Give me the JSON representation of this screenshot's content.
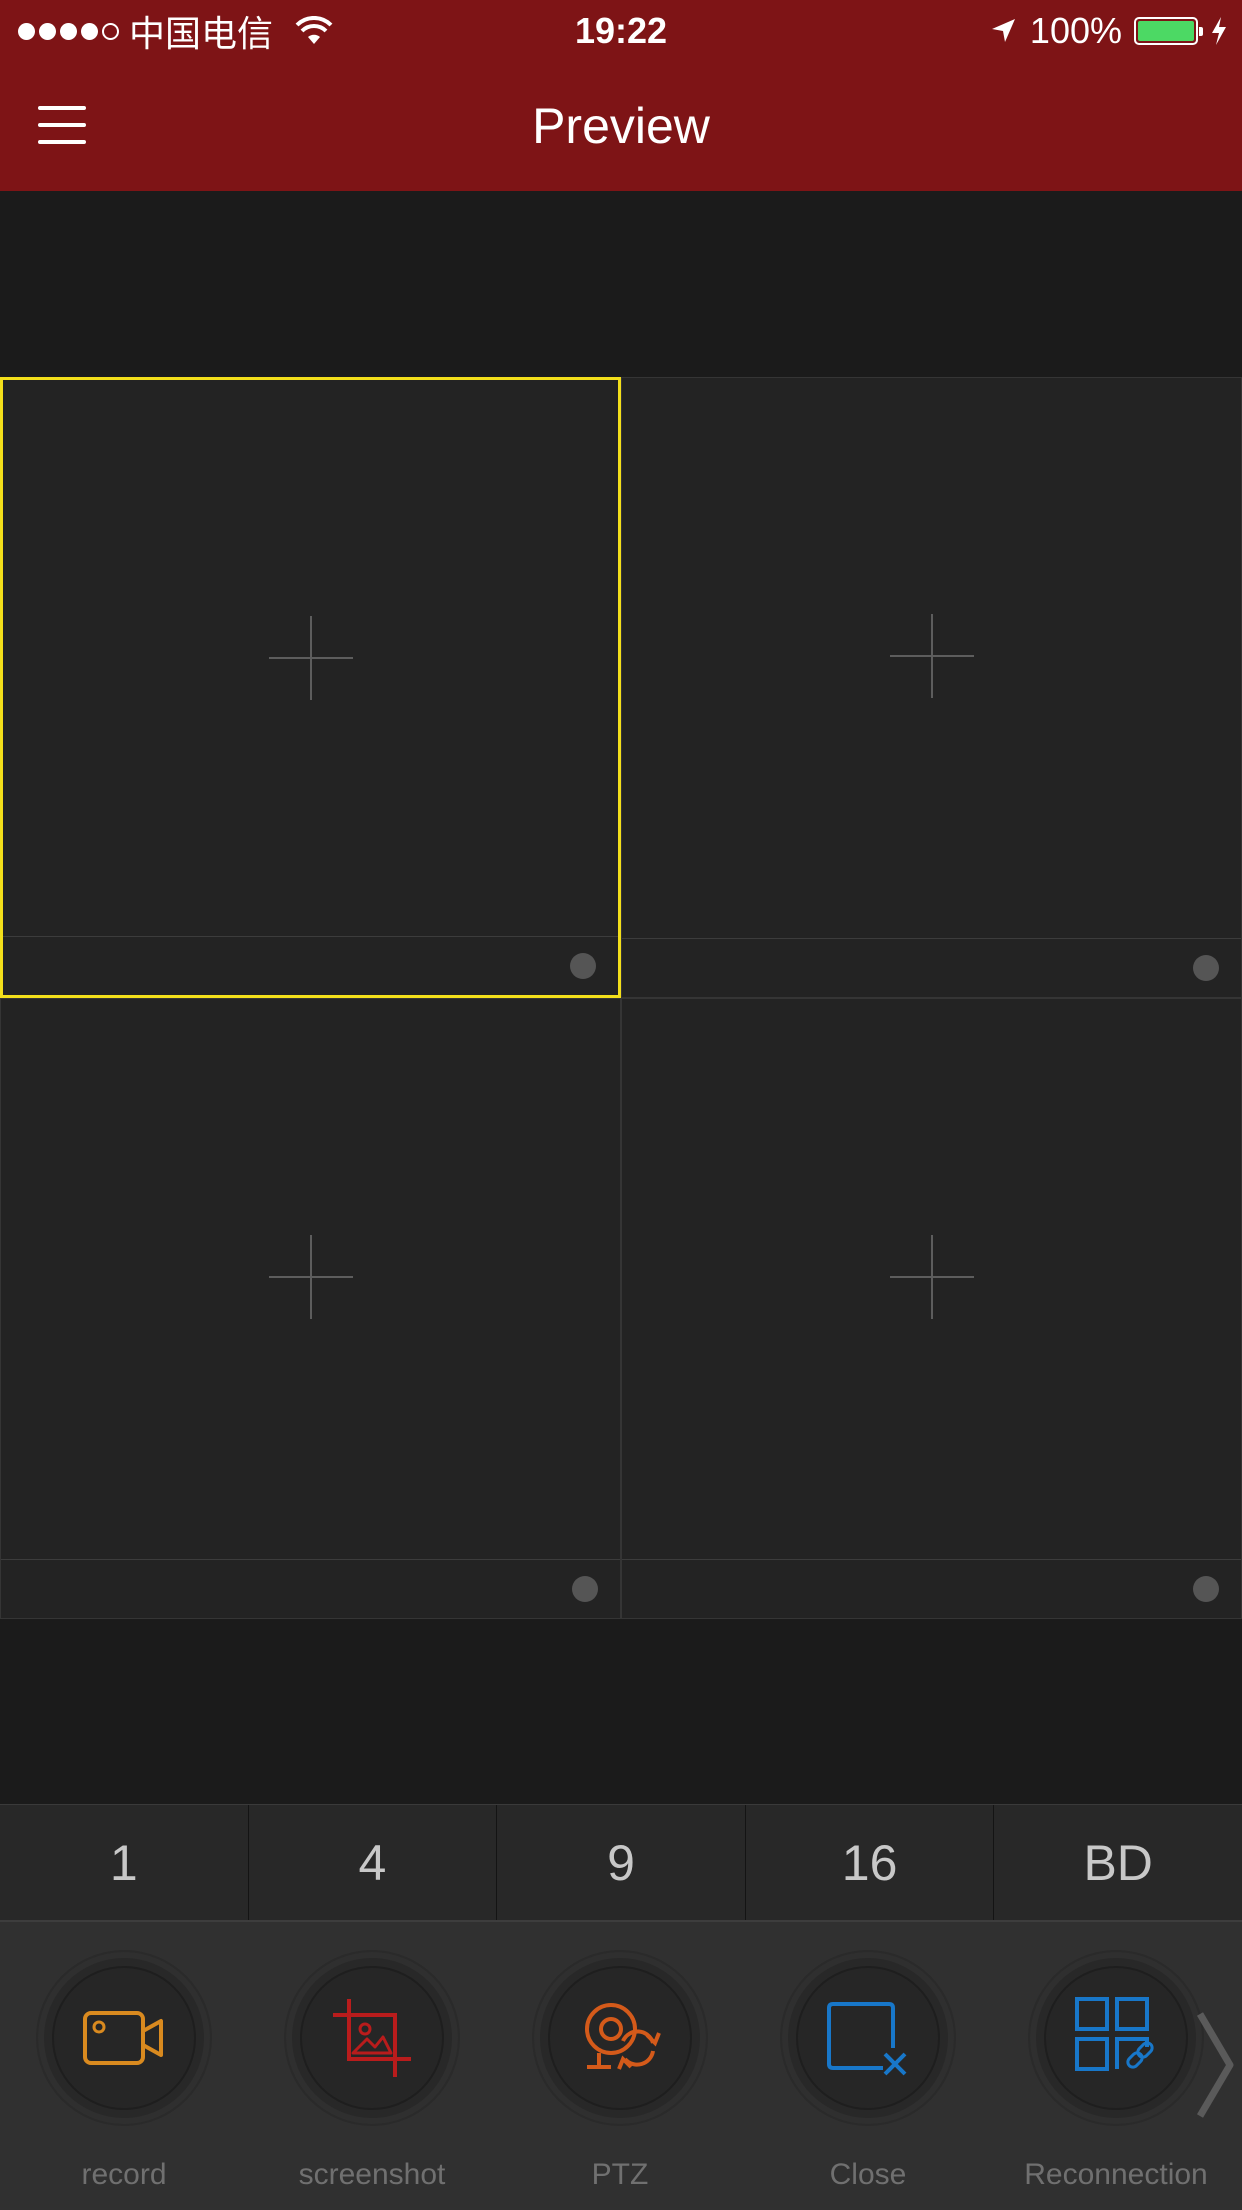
{
  "status_bar": {
    "carrier": "中国电信",
    "time": "19:22",
    "battery": "100%"
  },
  "navbar": {
    "title": "Preview"
  },
  "layout_options": [
    "1",
    "4",
    "9",
    "16",
    "BD"
  ],
  "toolbar": {
    "items": [
      {
        "label": "record",
        "icon": "video-camera-icon",
        "color": "#d98a1f"
      },
      {
        "label": "screenshot",
        "icon": "crop-image-icon",
        "color": "#b91c1c"
      },
      {
        "label": "PTZ",
        "icon": "ptz-rotate-icon",
        "color": "#d45a1a"
      },
      {
        "label": "Close",
        "icon": "close-window-icon",
        "color": "#1877c9"
      },
      {
        "label": "Reconnection",
        "icon": "grid-link-icon",
        "color": "#1877c9"
      }
    ]
  },
  "colors": {
    "header": "#7e1416",
    "selected_border": "#f3df1b",
    "battery": "#4cd964"
  }
}
